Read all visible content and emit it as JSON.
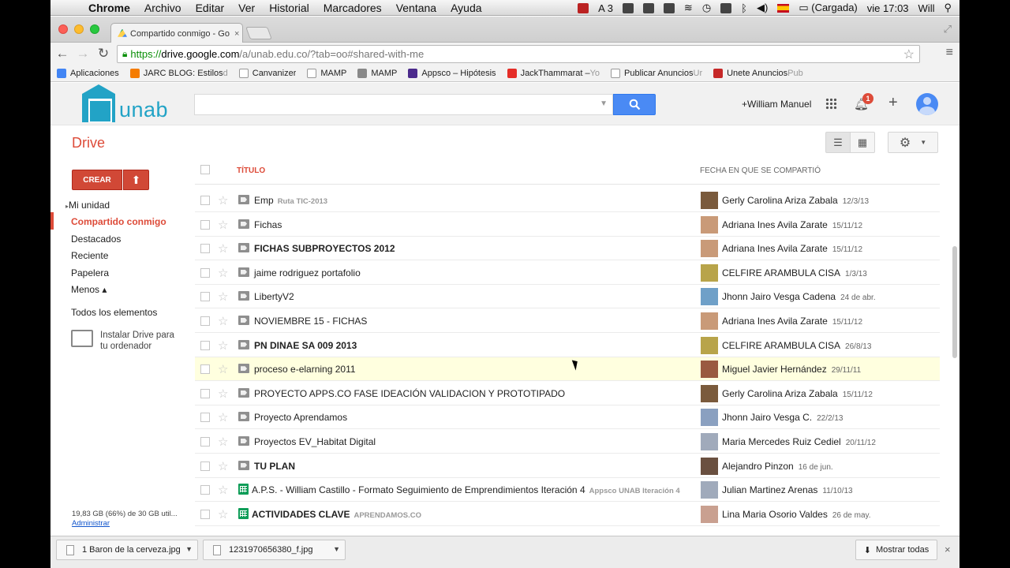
{
  "menubar": {
    "app": "Chrome",
    "items": [
      "Archivo",
      "Editar",
      "Ver",
      "Historial",
      "Marcadores",
      "Ventana",
      "Ayuda"
    ],
    "adobe_count": "3",
    "battery": "(Cargada)",
    "clock": "vie 17:03",
    "user": "Will"
  },
  "tab": {
    "title": "Compartido conmigo - Go"
  },
  "omnibox": {
    "scheme": "https://",
    "host": "drive.google.com",
    "path": "/a/unab.edu.co/?tab=oo#shared-with-me"
  },
  "bookmarks": [
    {
      "label": "Aplicaciones",
      "color": "#4285f4",
      "fade": ""
    },
    {
      "label": "JARC BLOG: Estilos ",
      "color": "#f57c00",
      "fade": "d"
    },
    {
      "label": "Canvanizer",
      "color": "#ffffff",
      "fade": ""
    },
    {
      "label": "MAMP",
      "color": "#ffffff",
      "fade": ""
    },
    {
      "label": "MAMP",
      "color": "#888888",
      "fade": ""
    },
    {
      "label": "Appsco – Hipótesis",
      "color": "#4b2a8c",
      "fade": ""
    },
    {
      "label": "JackThammarat – ",
      "color": "#e52d27",
      "fade": "Yo"
    },
    {
      "label": "Publicar Anuncios ",
      "color": "#ffffff",
      "fade": "Ur"
    },
    {
      "label": "Unete Anuncios ",
      "color": "#c62828",
      "fade": "Pub"
    }
  ],
  "header": {
    "logo_text": "unab",
    "user_name": "+William Manuel",
    "notification_count": "1"
  },
  "drive": {
    "title": "Drive"
  },
  "sidebar": {
    "create_label": "CREAR",
    "items": [
      {
        "label": "Mi unidad"
      },
      {
        "label": "Compartido conmigo"
      },
      {
        "label": "Destacados"
      },
      {
        "label": "Reciente"
      },
      {
        "label": "Papelera"
      },
      {
        "label": "Menos ▴"
      },
      {
        "label": "Todos los elementos"
      }
    ],
    "install_line1": "Instalar Drive para",
    "install_line2": "tu ordenador",
    "quota": "19,83 GB (66%) de 30 GB util...",
    "admin": "Administrar"
  },
  "list": {
    "title_header": "TÍTULO",
    "date_header": "FECHA EN QUE SE COMPARTIÓ",
    "rows": [
      {
        "title": "Emp",
        "tag": "Ruta TIC-2013",
        "owner": "Gerly Carolina Ariza Zabala",
        "date": "12/3/13",
        "bold": false,
        "type": "folder"
      },
      {
        "title": "Fichas",
        "tag": "",
        "owner": "Adriana Ines Avila Zarate",
        "date": "15/11/12",
        "bold": false,
        "type": "folder"
      },
      {
        "title": "FICHAS SUBPROYECTOS 2012",
        "tag": "",
        "owner": "Adriana Ines Avila Zarate",
        "date": "15/11/12",
        "bold": true,
        "type": "folder"
      },
      {
        "title": "jaime rodriguez portafolio",
        "tag": "",
        "owner": "CELFIRE ARAMBULA CISA",
        "date": "1/3/13",
        "bold": false,
        "type": "folder"
      },
      {
        "title": "LibertyV2",
        "tag": "",
        "owner": "Jhonn Jairo Vesga Cadena",
        "date": "24 de abr.",
        "bold": false,
        "type": "folder"
      },
      {
        "title": "NOVIEMBRE 15 - FICHAS",
        "tag": "",
        "owner": "Adriana Ines Avila Zarate",
        "date": "15/11/12",
        "bold": false,
        "type": "folder"
      },
      {
        "title": "PN DINAE SA 009 2013",
        "tag": "",
        "owner": "CELFIRE ARAMBULA CISA",
        "date": "26/8/13",
        "bold": true,
        "type": "folder"
      },
      {
        "title": "proceso e-elarning 2011",
        "tag": "",
        "owner": "Miguel Javier Hernández",
        "date": "29/11/11",
        "bold": false,
        "type": "folder"
      },
      {
        "title": "PROYECTO APPS.CO FASE IDEACIÓN VALIDACION Y PROTOTIPADO",
        "tag": "",
        "owner": "Gerly Carolina Ariza Zabala",
        "date": "15/11/12",
        "bold": false,
        "type": "folder"
      },
      {
        "title": "Proyecto Aprendamos",
        "tag": "",
        "owner": "Jhonn Jairo Vesga C.",
        "date": "22/2/13",
        "bold": false,
        "type": "folder"
      },
      {
        "title": "Proyectos EV_Habitat Digital",
        "tag": "",
        "owner": "Maria Mercedes Ruiz Cediel",
        "date": "20/11/12",
        "bold": false,
        "type": "folder"
      },
      {
        "title": "TU PLAN",
        "tag": "",
        "owner": "Alejandro Pinzon",
        "date": "16 de jun.",
        "bold": true,
        "type": "folder"
      },
      {
        "title": "A.P.S. - William Castillo - Formato Seguimiento de Emprendimientos Iteración 4",
        "tag": "Appsco UNAB Iteración 4",
        "owner": "Julian Martinez Arenas",
        "date": "11/10/13",
        "bold": false,
        "type": "sheet"
      },
      {
        "title": "ACTIVIDADES CLAVE",
        "tag": "APRENDAMOS.CO",
        "owner": "Lina Maria Osorio Valdes",
        "date": "26 de may.",
        "bold": true,
        "type": "sheet"
      }
    ]
  },
  "downloads": {
    "items": [
      "1 Baron de la cerveza.jpg",
      "1231970656380_f.jpg"
    ],
    "show_all": "Mostrar todas"
  }
}
